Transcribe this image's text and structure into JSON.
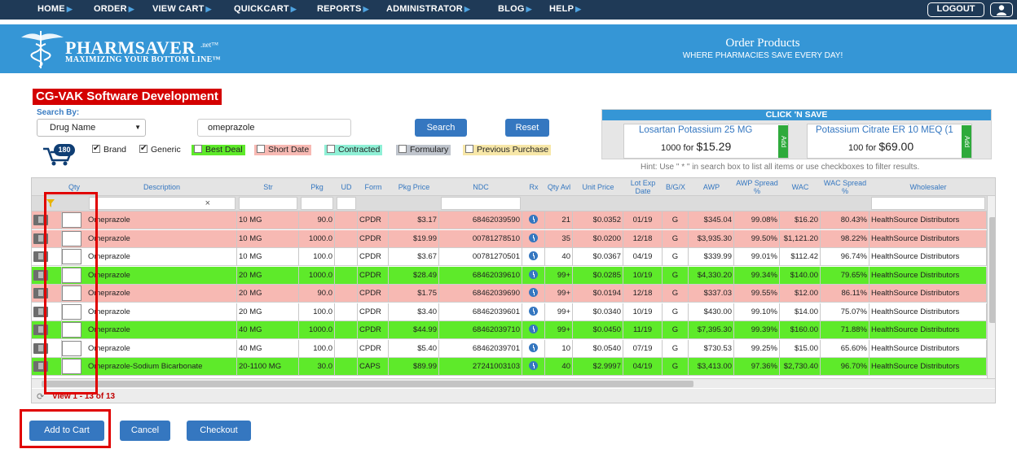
{
  "nav": {
    "items": [
      "HOME",
      "ORDER",
      "VIEW CART",
      "QUICKCART",
      "REPORTS",
      "ADMINISTRATOR",
      "BLOG",
      "HELP"
    ],
    "logout": "LOGOUT"
  },
  "banner": {
    "brand": "PHARMSAVER",
    "brand_suffix": ".net™",
    "tagline": "MAXIMIZING YOUR BOTTOM LINE™",
    "title": "Order Products",
    "subtitle": "WHERE PHARMACIES SAVE EVERY DAY!"
  },
  "company": "CG-VAK Software Development",
  "search": {
    "search_by_label": "Search By:",
    "drug_select": "Drug Name",
    "query": "omeprazole",
    "search_btn": "Search",
    "reset_btn": "Reset",
    "cart_count": "180"
  },
  "filters": {
    "brand": "Brand",
    "generic": "Generic",
    "best_deal": "Best Deal",
    "short_date": "Short Date",
    "contracted": "Contracted",
    "formulary": "Formulary",
    "previous_purchase": "Previous Purchase"
  },
  "colors": {
    "best_deal": "#5eea2a",
    "short_date": "#f7b9b3",
    "contracted": "#8ff0d6",
    "formulary": "#bfc4cc",
    "previous_purchase": "#f7e7a8"
  },
  "click_n_save": {
    "title": "CLICK 'N SAVE",
    "cards": [
      {
        "name": "Losartan Potassium 25 MG",
        "qty": "1000 for",
        "price": "$15.29",
        "tag": "Add"
      },
      {
        "name": "Potassium Citrate ER 10 MEQ (1",
        "qty": "100 for",
        "price": "$69.00",
        "tag": "Add"
      }
    ],
    "hint": "Hint: Use \" * \" in search box to list all items or use checkboxes to filter results."
  },
  "grid": {
    "headers": [
      "Qty",
      "Description",
      "Str",
      "Pkg",
      "UD",
      "Form",
      "Pkg Price",
      "NDC",
      "Rx",
      "Qty Avl",
      "Unit Price",
      "Lot Exp Date",
      "B/G/X",
      "AWP",
      "AWP Spread %",
      "WAC",
      "WAC Spread %",
      "Wholesaler"
    ],
    "filter_clear": "×",
    "rows": [
      {
        "style": "pink",
        "desc": "Omeprazole",
        "str": "10 MG",
        "pkg": "90.0",
        "form": "CPDR",
        "price": "$3.17",
        "ndc": "68462039590",
        "qty": "21",
        "unit": "$0.0352",
        "exp": "01/19",
        "bgx": "G",
        "awp": "$345.04",
        "awp_sp": "99.08%",
        "wac": "$16.20",
        "wac_sp": "80.43%",
        "who": "HealthSource Distributors"
      },
      {
        "style": "pink",
        "desc": "Omeprazole",
        "str": "10 MG",
        "pkg": "1000.0",
        "form": "CPDR",
        "price": "$19.99",
        "ndc": "00781278510",
        "qty": "35",
        "unit": "$0.0200",
        "exp": "12/18",
        "bgx": "G",
        "awp": "$3,935.30",
        "awp_sp": "99.50%",
        "wac": "$1,121.20",
        "wac_sp": "98.22%",
        "who": "HealthSource Distributors"
      },
      {
        "style": "white",
        "desc": "Omeprazole",
        "str": "10 MG",
        "pkg": "100.0",
        "form": "CPDR",
        "price": "$3.67",
        "ndc": "00781270501",
        "qty": "40",
        "unit": "$0.0367",
        "exp": "04/19",
        "bgx": "G",
        "awp": "$339.99",
        "awp_sp": "99.01%",
        "wac": "$112.42",
        "wac_sp": "96.74%",
        "who": "HealthSource Distributors"
      },
      {
        "style": "green",
        "desc": "Omeprazole",
        "str": "20 MG",
        "pkg": "1000.0",
        "form": "CPDR",
        "price": "$28.49",
        "ndc": "68462039610",
        "qty": "99+",
        "unit": "$0.0285",
        "exp": "10/19",
        "bgx": "G",
        "awp": "$4,330.20",
        "awp_sp": "99.34%",
        "wac": "$140.00",
        "wac_sp": "79.65%",
        "who": "HealthSource Distributors"
      },
      {
        "style": "pink",
        "desc": "Omeprazole",
        "str": "20 MG",
        "pkg": "90.0",
        "form": "CPDR",
        "price": "$1.75",
        "ndc": "68462039690",
        "qty": "99+",
        "unit": "$0.0194",
        "exp": "12/18",
        "bgx": "G",
        "awp": "$337.03",
        "awp_sp": "99.55%",
        "wac": "$12.00",
        "wac_sp": "86.11%",
        "who": "HealthSource Distributors"
      },
      {
        "style": "white",
        "desc": "Omeprazole",
        "str": "20 MG",
        "pkg": "100.0",
        "form": "CPDR",
        "price": "$3.40",
        "ndc": "68462039601",
        "qty": "99+",
        "unit": "$0.0340",
        "exp": "10/19",
        "bgx": "G",
        "awp": "$430.00",
        "awp_sp": "99.10%",
        "wac": "$14.00",
        "wac_sp": "75.07%",
        "who": "HealthSource Distributors"
      },
      {
        "style": "green",
        "desc": "Omeprazole",
        "str": "40 MG",
        "pkg": "1000.0",
        "form": "CPDR",
        "price": "$44.99",
        "ndc": "68462039710",
        "qty": "99+",
        "unit": "$0.0450",
        "exp": "11/19",
        "bgx": "G",
        "awp": "$7,395.30",
        "awp_sp": "99.39%",
        "wac": "$160.00",
        "wac_sp": "71.88%",
        "who": "HealthSource Distributors"
      },
      {
        "style": "white",
        "desc": "Omeprazole",
        "str": "40 MG",
        "pkg": "100.0",
        "form": "CPDR",
        "price": "$5.40",
        "ndc": "68462039701",
        "qty": "10",
        "unit": "$0.0540",
        "exp": "07/19",
        "bgx": "G",
        "awp": "$730.53",
        "awp_sp": "99.25%",
        "wac": "$15.00",
        "wac_sp": "65.60%",
        "who": "HealthSource Distributors"
      },
      {
        "style": "green",
        "desc": "Omeprazole-Sodium Bicarbonate",
        "str": "20-1100 MG",
        "pkg": "30.0",
        "form": "CAPS",
        "price": "$89.99",
        "ndc": "27241003103",
        "qty": "40",
        "unit": "$2.9997",
        "exp": "04/19",
        "bgx": "G",
        "awp": "$3,413.00",
        "awp_sp": "97.36%",
        "wac": "$2,730.40",
        "wac_sp": "96.70%",
        "who": "HealthSource Distributors"
      }
    ],
    "pager": "View 1 - 13 of 13"
  },
  "buttons": {
    "add_to_cart": "Add to Cart",
    "cancel": "Cancel",
    "checkout": "Checkout"
  }
}
